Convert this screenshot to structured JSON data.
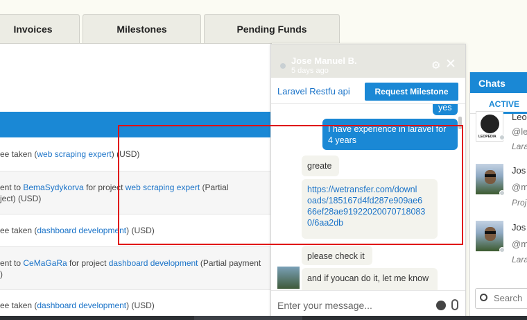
{
  "tabs": [
    {
      "label": "Invoices"
    },
    {
      "label": "Milestones"
    },
    {
      "label": "Pending Funds"
    }
  ],
  "transactions": [
    {
      "pre": "ee taken (",
      "link": "web scraping expert",
      "post": ") (USD)"
    },
    {
      "line1_pre": "ent to ",
      "line1_link1": "BemaSydykorva",
      "line1_mid": " for project ",
      "line1_link2": "web scraping expert",
      "line1_post": " (Partial",
      "line2": "ject) (USD)"
    },
    {
      "pre": "ee taken (",
      "link": "dashboard development",
      "post": ") (USD)"
    },
    {
      "line1_pre": "ent to ",
      "line1_link1": "CeMaGaRa",
      "line1_mid": " for project ",
      "line1_link2": "dashboard development",
      "line1_post": " (Partial payment",
      "line2": ")"
    },
    {
      "pre": "ee taken (",
      "link": "dashboard development",
      "post": ") (USD)"
    }
  ],
  "chat": {
    "name": "Jose Manuel B.",
    "last_seen": "5 days ago",
    "project_link": "Laravel Restfu api",
    "request_button": "Request Milestone",
    "messages": [
      {
        "direction": "out",
        "text": "yes"
      },
      {
        "direction": "out",
        "text": "I have experience in laravel for 4 years"
      },
      {
        "direction": "in",
        "text": "greate"
      },
      {
        "direction": "in",
        "url_lines": [
          "https://wetransfer.com/downl",
          "oads/185167d4fd287e909ae6",
          "66ef28ae91922020070718083",
          "0/6aa2db"
        ]
      },
      {
        "direction": "in",
        "text": "please check it"
      },
      {
        "direction": "in",
        "text": "and if youcan do it, let me know"
      }
    ],
    "input_placeholder": "Enter your message..."
  },
  "sidebar": {
    "title": "Chats",
    "active_tab": "ACTIVE",
    "items": [
      {
        "name": "Leo",
        "handle": "@le",
        "preview": "Lara",
        "avatar": "leopedia-logo",
        "logo_text": "LEOPEDIA"
      },
      {
        "name": "Jos",
        "handle": "@m",
        "preview": "Proj",
        "avatar": "person-photo"
      },
      {
        "name": "Jos",
        "handle": "@m",
        "preview": "Lara",
        "avatar": "person-photo"
      }
    ],
    "search_placeholder": "Search"
  },
  "colors": {
    "accent": "#1a88d5",
    "highlight": "#e01010"
  }
}
